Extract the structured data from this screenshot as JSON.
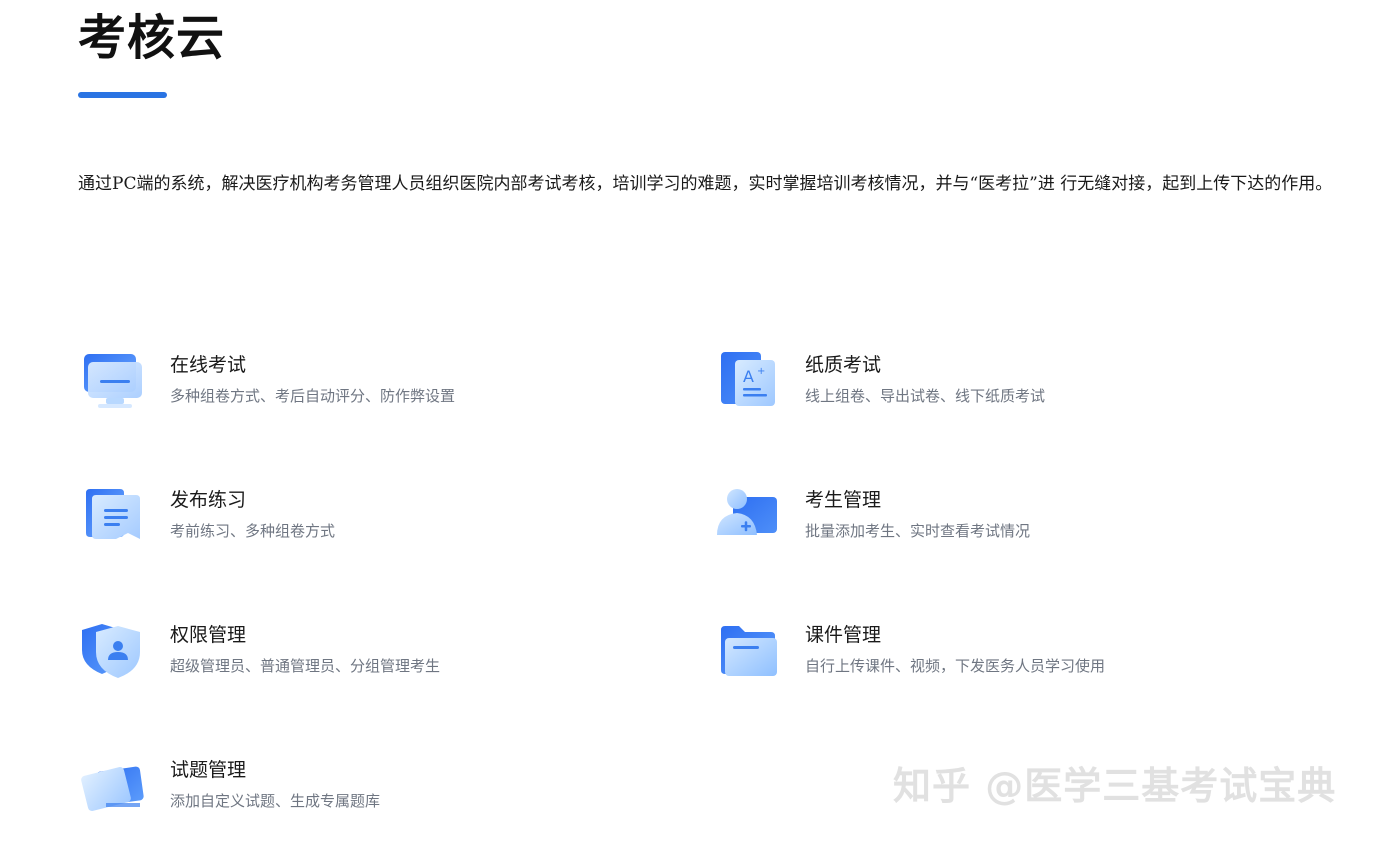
{
  "header": {
    "title": "考核云",
    "description": "通过PC端的系统，解决医疗机构考务管理人员组织医院内部考试考核，培训学习的难题，实时掌握培训考核情况，并与“医考拉”进 行无缝对接，起到上传下达的作用。"
  },
  "features": [
    {
      "name": "在线考试",
      "sub": "多种组卷方式、考后自动评分、防作弊设置",
      "icon": "monitor-icon"
    },
    {
      "name": "纸质考试",
      "sub": "线上组卷、导出试卷、线下纸质考试",
      "icon": "paper-exam-icon"
    },
    {
      "name": "发布练习",
      "sub": "考前练习、多种组卷方式",
      "icon": "practice-doc-icon"
    },
    {
      "name": "考生管理",
      "sub": "批量添加考生、实时查看考试情况",
      "icon": "add-examinee-icon"
    },
    {
      "name": "权限管理",
      "sub": "超级管理员、普通管理员、分组管理考生",
      "icon": "shield-user-icon"
    },
    {
      "name": "课件管理",
      "sub": "自行上传课件、视频，下发医务人员学习使用",
      "icon": "folder-icon"
    },
    {
      "name": "试题管理",
      "sub": "添加自定义试题、生成专属题库",
      "icon": "question-bank-icon"
    }
  ],
  "watermark": "知乎 @医学三基考试宝典",
  "colors": {
    "accent": "#2a74e3",
    "subtext": "#6f7682",
    "icon_light": "#a9d0ff",
    "icon_dark": "#3b7ff0"
  }
}
